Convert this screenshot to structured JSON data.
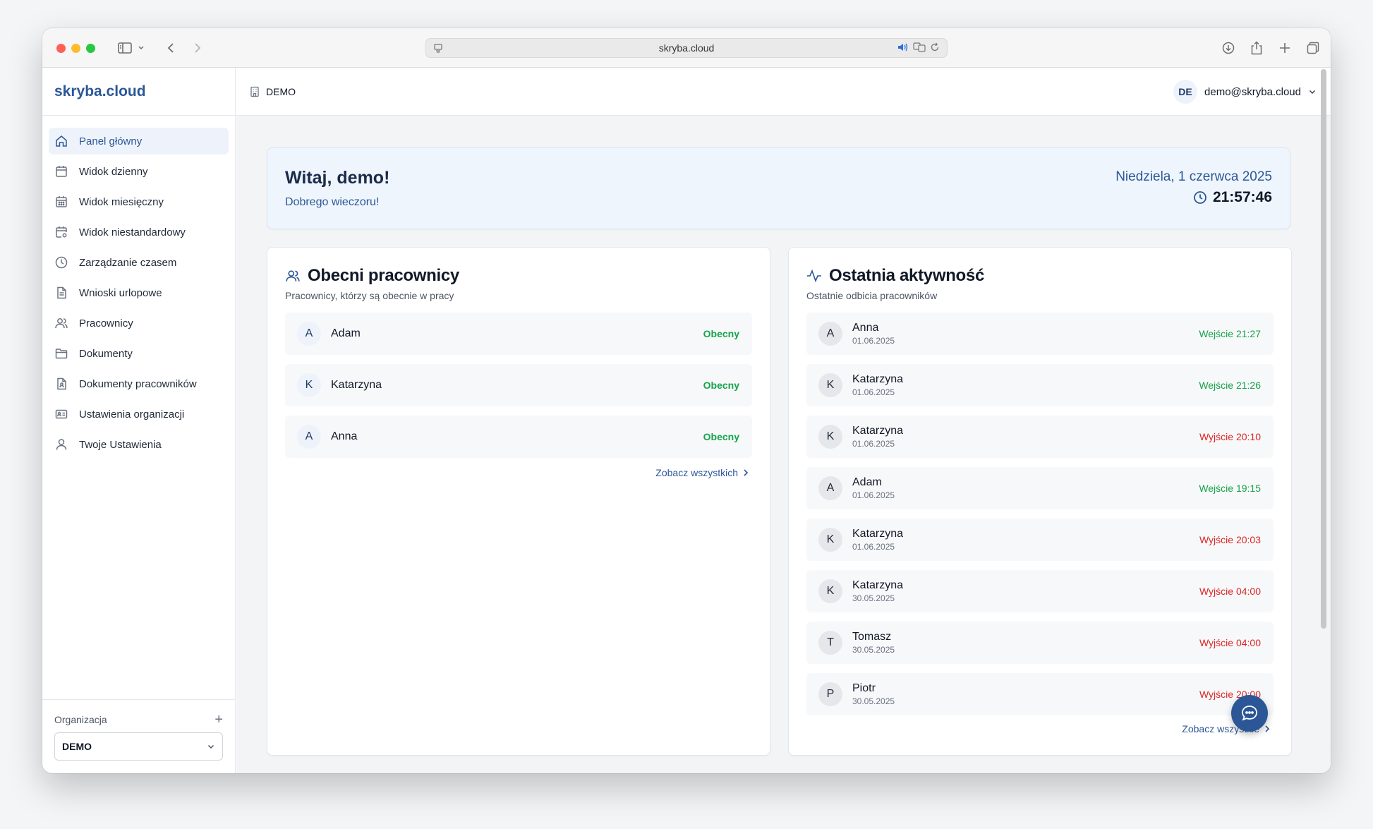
{
  "browser": {
    "url": "skryba.cloud"
  },
  "app": {
    "brand": "skryba.cloud",
    "accent_color": "#2b5797"
  },
  "sidebar": {
    "items": [
      {
        "label": "Panel główny",
        "icon": "home-icon",
        "active": true
      },
      {
        "label": "Widok dzienny",
        "icon": "calendar-icon"
      },
      {
        "label": "Widok miesięczny",
        "icon": "calendar-grid-icon"
      },
      {
        "label": "Widok niestandardowy",
        "icon": "calendar-settings-icon"
      },
      {
        "label": "Zarządzanie czasem",
        "icon": "clock-icon"
      },
      {
        "label": "Wnioski urlopowe",
        "icon": "document-icon"
      },
      {
        "label": "Pracownicy",
        "icon": "users-icon"
      },
      {
        "label": "Dokumenty",
        "icon": "folder-icon"
      },
      {
        "label": "Dokumenty pracowników",
        "icon": "user-document-icon"
      },
      {
        "label": "Ustawienia organizacji",
        "icon": "id-card-icon"
      },
      {
        "label": "Twoje Ustawienia",
        "icon": "user-icon"
      }
    ],
    "org_label": "Organizacja",
    "org_selected": "DEMO"
  },
  "topbar": {
    "org_name": "DEMO",
    "user_initials": "DE",
    "user_email": "demo@skryba.cloud"
  },
  "welcome": {
    "title": "Witaj, demo!",
    "greeting": "Dobrego wieczoru!",
    "date": "Niedziela, 1 czerwca 2025",
    "time": "21:57:46"
  },
  "present": {
    "title": "Obecni pracownicy",
    "subtitle": "Pracownicy, którzy są obecnie w pracy",
    "rows": [
      {
        "initial": "A",
        "name": "Adam",
        "status": "Obecny"
      },
      {
        "initial": "K",
        "name": "Katarzyna",
        "status": "Obecny"
      },
      {
        "initial": "A",
        "name": "Anna",
        "status": "Obecny"
      }
    ],
    "link": "Zobacz wszystkich"
  },
  "activity": {
    "title": "Ostatnia aktywność",
    "subtitle": "Ostatnie odbicia pracowników",
    "rows": [
      {
        "initial": "A",
        "name": "Anna",
        "date": "01.06.2025",
        "event": "Wejście 21:27",
        "type": "in"
      },
      {
        "initial": "K",
        "name": "Katarzyna",
        "date": "01.06.2025",
        "event": "Wejście 21:26",
        "type": "in"
      },
      {
        "initial": "K",
        "name": "Katarzyna",
        "date": "01.06.2025",
        "event": "Wyjście 20:10",
        "type": "out"
      },
      {
        "initial": "A",
        "name": "Adam",
        "date": "01.06.2025",
        "event": "Wejście 19:15",
        "type": "in"
      },
      {
        "initial": "K",
        "name": "Katarzyna",
        "date": "01.06.2025",
        "event": "Wyjście 20:03",
        "type": "out"
      },
      {
        "initial": "K",
        "name": "Katarzyna",
        "date": "30.05.2025",
        "event": "Wyjście 04:00",
        "type": "out"
      },
      {
        "initial": "T",
        "name": "Tomasz",
        "date": "30.05.2025",
        "event": "Wyjście 04:00",
        "type": "out"
      },
      {
        "initial": "P",
        "name": "Piotr",
        "date": "30.05.2025",
        "event": "Wyjście 20:00",
        "type": "out"
      }
    ],
    "link": "Zobacz wszystkie"
  }
}
